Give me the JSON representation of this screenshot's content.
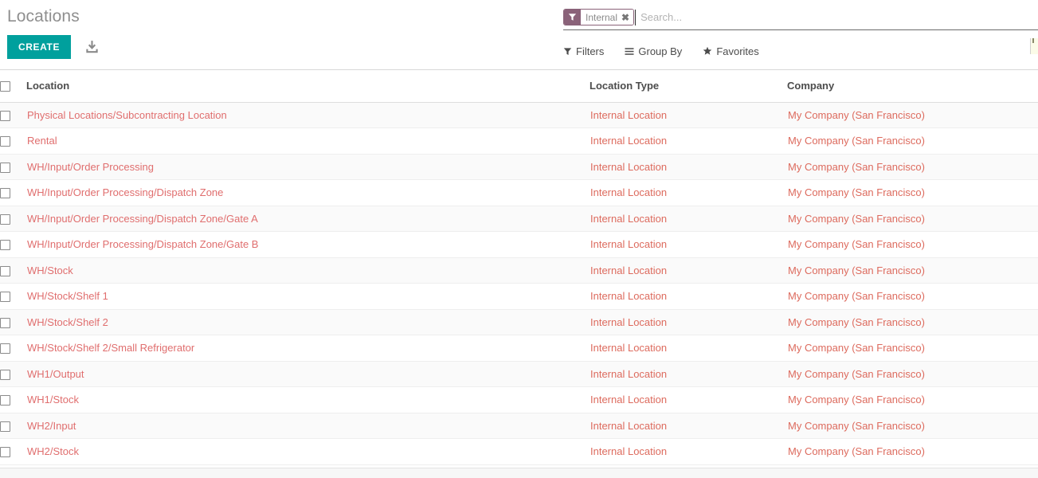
{
  "breadcrumb": "Locations",
  "buttons": {
    "create_label": "CREATE",
    "import_icon": "import-download-icon"
  },
  "search": {
    "facet": {
      "icon": "filter-funnel-icon",
      "label": "Internal",
      "remove_icon": "close-x-icon"
    },
    "placeholder": "Search...",
    "value": ""
  },
  "filter_menus": [
    {
      "label": "Filters",
      "icon": "filter-funnel-icon"
    },
    {
      "label": "Group By",
      "icon": "list-lines-icon"
    },
    {
      "label": "Favorites",
      "icon": "star-icon"
    }
  ],
  "colors": {
    "create_button": "#00a09d",
    "facet_tag": "#8a6279",
    "row_link": "#e06e6e",
    "cell_link": "#dd6b5e",
    "header_text": "#4c4c4c",
    "breadcrumb_text": "#8f8f8f"
  },
  "table": {
    "columns": [
      "Location",
      "Location Type",
      "Company"
    ],
    "rows": [
      {
        "location": "Physical Locations/Subcontracting Location",
        "type": "Internal Location",
        "company": "My Company (San Francisco)"
      },
      {
        "location": "Rental",
        "type": "Internal Location",
        "company": "My Company (San Francisco)"
      },
      {
        "location": "WH/Input/Order Processing",
        "type": "Internal Location",
        "company": "My Company (San Francisco)"
      },
      {
        "location": "WH/Input/Order Processing/Dispatch Zone",
        "type": "Internal Location",
        "company": "My Company (San Francisco)"
      },
      {
        "location": "WH/Input/Order Processing/Dispatch Zone/Gate A",
        "type": "Internal Location",
        "company": "My Company (San Francisco)"
      },
      {
        "location": "WH/Input/Order Processing/Dispatch Zone/Gate B",
        "type": "Internal Location",
        "company": "My Company (San Francisco)"
      },
      {
        "location": "WH/Stock",
        "type": "Internal Location",
        "company": "My Company (San Francisco)"
      },
      {
        "location": "WH/Stock/Shelf 1",
        "type": "Internal Location",
        "company": "My Company (San Francisco)"
      },
      {
        "location": "WH/Stock/Shelf 2",
        "type": "Internal Location",
        "company": "My Company (San Francisco)"
      },
      {
        "location": "WH/Stock/Shelf 2/Small Refrigerator",
        "type": "Internal Location",
        "company": "My Company (San Francisco)"
      },
      {
        "location": "WH1/Output",
        "type": "Internal Location",
        "company": "My Company (San Francisco)"
      },
      {
        "location": "WH1/Stock",
        "type": "Internal Location",
        "company": "My Company (San Francisco)"
      },
      {
        "location": "WH2/Input",
        "type": "Internal Location",
        "company": "My Company (San Francisco)"
      },
      {
        "location": "WH2/Stock",
        "type": "Internal Location",
        "company": "My Company (San Francisco)"
      }
    ]
  }
}
